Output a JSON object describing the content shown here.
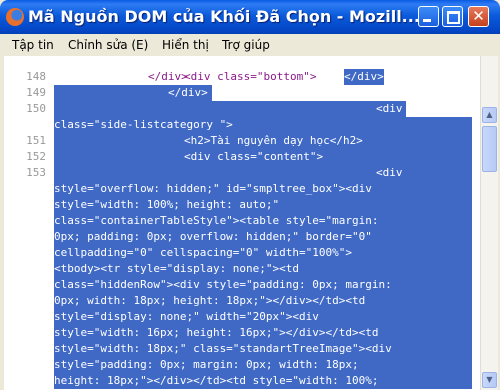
{
  "window": {
    "title": "Mã Nguồn DOM của Khối Đã Chọn - Mozill..."
  },
  "menu": [
    {
      "label": "Tập tin"
    },
    {
      "label": "Chỉnh sửa (E)"
    },
    {
      "label": "Hiển thị"
    },
    {
      "label": "Trợ giúp"
    }
  ],
  "source": {
    "top_fragment": "</div>",
    "lines": [
      {
        "num": "148",
        "text": "<div class=\"bottom\">",
        "sel": "</div>"
      },
      {
        "num": "149",
        "text": "",
        "sel": "</div>"
      },
      {
        "num": "150",
        "text": "",
        "sel": "<div"
      },
      {
        "num": "",
        "text": "",
        "sel": "class=\"side-listcategory \">"
      },
      {
        "num": "151",
        "text": "",
        "sel": "<h2>Tài nguyên dạy học</h2>"
      },
      {
        "num": "152",
        "text": "",
        "sel": "<div class=\"content\">"
      },
      {
        "num": "153",
        "text": "",
        "sel": "<div"
      },
      {
        "num": "",
        "text": "",
        "sel": "style=\"overflow: hidden;\" id=\"smpltree_box\"><div"
      },
      {
        "num": "",
        "text": "",
        "sel": "style=\"width: 100%; height: auto;\""
      },
      {
        "num": "",
        "text": "",
        "sel": "class=\"containerTableStyle\"><table style=\"margin:"
      },
      {
        "num": "",
        "text": "",
        "sel": "0px; padding: 0px; overflow: hidden;\" border=\"0\""
      },
      {
        "num": "",
        "text": "",
        "sel": "cellpadding=\"0\" cellspacing=\"0\" width=\"100%\">"
      },
      {
        "num": "",
        "text": "",
        "sel": "<tbody><tr style=\"display: none;\"><td"
      },
      {
        "num": "",
        "text": "",
        "sel": "class=\"hiddenRow\"><div style=\"padding: 0px; margin:"
      },
      {
        "num": "",
        "text": "",
        "sel": "0px; width: 18px; height: 18px;\"></div></td><td"
      },
      {
        "num": "",
        "text": "",
        "sel": "style=\"display: none;\" width=\"20px\"><div"
      },
      {
        "num": "",
        "text": "",
        "sel": "style=\"width: 16px; height: 16px;\"></div></td><td"
      },
      {
        "num": "",
        "text": "",
        "sel": "style=\"width: 18px;\" class=\"standartTreeImage\"><div"
      },
      {
        "num": "",
        "text": "",
        "sel": "style=\"padding: 0px; margin: 0px; width: 18px;"
      },
      {
        "num": "",
        "text": "",
        "sel": "height: 18px;\"></div></td><td style=\"width: 100%;"
      }
    ]
  }
}
